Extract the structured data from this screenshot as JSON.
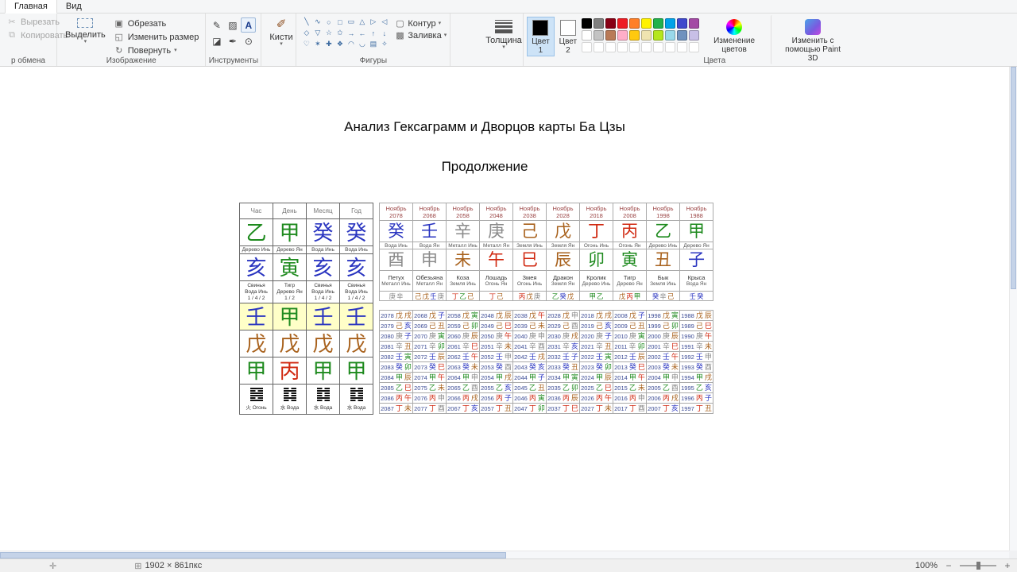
{
  "icons": {
    "cut": "✂",
    "copy": "⧉",
    "crop": "▣",
    "resize": "◱",
    "rotate": "↻",
    "pencil": "✎",
    "fill": "▨",
    "text": "A",
    "eraser": "◪",
    "eyedropper": "✒",
    "magnifier": "⊙",
    "brush": "✐",
    "outline": "▢",
    "fill_shape": "▩",
    "caret": "▾",
    "position": "✛",
    "canvas_size": "⊞",
    "zoom_out": "−",
    "zoom_in": "+"
  },
  "ribbon": {
    "tabs": [
      {
        "label": "Главная",
        "active": true
      },
      {
        "label": "Вид",
        "active": false
      }
    ],
    "clipboard": {
      "cut": "Вырезать",
      "copy": "Копировать",
      "group_label": "р обмена"
    },
    "image": {
      "select": "Выделить",
      "crop": "Обрезать",
      "resize": "Изменить размер",
      "rotate": "Повернуть",
      "group_label": "Изображение"
    },
    "tools": {
      "group_label": "Инструменты"
    },
    "brushes": {
      "label": "Кисти"
    },
    "shapes": {
      "glyphs": [
        "╲",
        "∿",
        "○",
        "□",
        "▭",
        "△",
        "▷",
        "◁",
        "◇",
        "▽",
        "☆",
        "✩",
        "→",
        "←",
        "↑",
        "↓",
        "♡",
        "✶",
        "✚",
        "❖",
        "◠",
        "◡",
        "▤",
        "✧"
      ],
      "outline": "Контур",
      "fill": "Заливка",
      "group_label": "Фигуры"
    },
    "size": {
      "label": "Толщина"
    },
    "color1": {
      "label": "Цвет",
      "number": "1",
      "value": "#000000"
    },
    "color2": {
      "label": "Цвет",
      "number": "2",
      "value": "#ffffff"
    },
    "palette": {
      "row1": [
        "#000000",
        "#7f7f7f",
        "#880015",
        "#ed1c24",
        "#ff7f27",
        "#fff200",
        "#22b14c",
        "#00a2e8",
        "#3f48cc",
        "#a349a4"
      ],
      "row2": [
        "#ffffff",
        "#c3c3c3",
        "#b97a57",
        "#ffaec9",
        "#ffc90e",
        "#efe4b0",
        "#b5e61d",
        "#99d9ea",
        "#7092be",
        "#c8bfe7"
      ],
      "empty_count": 10,
      "group_label": "Цвета"
    },
    "edit_colors": "Изменение цветов",
    "paint3d": "Изменить с помощью Paint 3D"
  },
  "canvas": {
    "title": "Анализ Гексаграмм и Дворцов карты Ба Цзы",
    "subtitle": "Продолжение",
    "element_colors": {
      "wood": "#1e8a1e",
      "fire": "#d02810",
      "earth": "#a8611c",
      "metal": "#8a8a8a",
      "water": "#2a35c0"
    },
    "char_elements": {
      "甲": "wood",
      "乙": "wood",
      "丙": "fire",
      "丁": "fire",
      "戊": "earth",
      "己": "earth",
      "庚": "metal",
      "辛": "metal",
      "壬": "water",
      "癸": "water",
      "子": "water",
      "丑": "earth",
      "寅": "wood",
      "卯": "wood",
      "辰": "earth",
      "巳": "fire",
      "午": "fire",
      "未": "earth",
      "申": "metal",
      "酉": "metal",
      "戌": "earth",
      "亥": "water"
    },
    "pillars_table": {
      "headers": [
        "Час",
        "День",
        "Месяц",
        "Год"
      ],
      "stems": [
        "乙",
        "甲",
        "癸",
        "癸"
      ],
      "stem_labels": [
        "Дерево Инь",
        "Дерево Ян",
        "Вода Инь",
        "Вода Инь"
      ],
      "branches": [
        "亥",
        "寅",
        "亥",
        "亥"
      ],
      "branch_info": [
        [
          "Свинья",
          "Вода Инь",
          "1 / 4 / 2"
        ],
        [
          "Тигр",
          "Дерево Ян",
          "1 / 2"
        ],
        [
          "Свинья",
          "Вода Инь",
          "1 / 4 / 2"
        ],
        [
          "Свинья",
          "Вода Инь",
          "1 / 4 / 2"
        ]
      ],
      "hidden_rows": [
        {
          "highlight": true,
          "chars": [
            "壬",
            "甲",
            "壬",
            "壬"
          ]
        },
        {
          "highlight": false,
          "chars": [
            "戊",
            "戊",
            "戊",
            "戊"
          ]
        },
        {
          "highlight": false,
          "chars": [
            "甲",
            "丙",
            "甲",
            "甲"
          ]
        }
      ],
      "hexagrams": [
        {
          "lines": [
            1,
            0,
            1,
            1,
            0,
            1
          ],
          "label": "火 Огонь"
        },
        {
          "lines": [
            0,
            1,
            0,
            0,
            1,
            0
          ],
          "label": "水 Вода"
        },
        {
          "lines": [
            0,
            1,
            0,
            0,
            1,
            0
          ],
          "label": "水 Вода"
        },
        {
          "lines": [
            0,
            1,
            0,
            0,
            1,
            0
          ],
          "label": "水 Вода"
        }
      ]
    },
    "luck_table": {
      "columns": [
        {
          "month": "Ноябрь",
          "year": "2078",
          "stem": "癸",
          "stem_label": "Вода Инь",
          "branch": "酉",
          "animal": "Петух",
          "branch_label": "Металл Инь",
          "hidden": "庚辛"
        },
        {
          "month": "Ноябрь",
          "year": "2068",
          "stem": "壬",
          "stem_label": "Вода Ян",
          "branch": "申",
          "animal": "Обезьяна",
          "branch_label": "Металл Ян",
          "hidden": "己戊壬庚"
        },
        {
          "month": "Ноябрь",
          "year": "2058",
          "stem": "辛",
          "stem_label": "Металл Инь",
          "branch": "未",
          "animal": "Коза",
          "branch_label": "Земля Инь",
          "hidden": "丁乙己"
        },
        {
          "month": "Ноябрь",
          "year": "2048",
          "stem": "庚",
          "stem_label": "Металл Ян",
          "branch": "午",
          "animal": "Лошадь",
          "branch_label": "Огонь Ян",
          "hidden": "丁己"
        },
        {
          "month": "Ноябрь",
          "year": "2038",
          "stem": "己",
          "stem_label": "Земля Инь",
          "branch": "巳",
          "animal": "Змея",
          "branch_label": "Огонь Инь",
          "hidden": "丙戊庚"
        },
        {
          "month": "Ноябрь",
          "year": "2028",
          "stem": "戊",
          "stem_label": "Земля Ян",
          "branch": "辰",
          "animal": "Дракон",
          "branch_label": "Земля Ян",
          "hidden": "乙癸戊"
        },
        {
          "month": "Ноябрь",
          "year": "2018",
          "stem": "丁",
          "stem_label": "Огонь Инь",
          "branch": "卯",
          "animal": "Кролик",
          "branch_label": "Дерево Инь",
          "hidden": "甲乙"
        },
        {
          "month": "Ноябрь",
          "year": "2008",
          "stem": "丙",
          "stem_label": "Огонь Ян",
          "branch": "寅",
          "animal": "Тигр",
          "branch_label": "Дерево Ян",
          "hidden": "戊丙甲"
        },
        {
          "month": "Ноябрь",
          "year": "1998",
          "stem": "乙",
          "stem_label": "Дерево Инь",
          "branch": "丑",
          "animal": "Бык",
          "branch_label": "Земля Инь",
          "hidden": "癸辛己"
        },
        {
          "month": "Ноябрь",
          "year": "1988",
          "stem": "甲",
          "stem_label": "Дерево Ян",
          "branch": "子",
          "animal": "Крыса",
          "branch_label": "Вода Ян",
          "hidden": "壬癸"
        }
      ]
    },
    "years_table": {
      "columns": [
        {
          "cells": [
            [
              "2078",
              "戊戌"
            ],
            [
              "2079",
              "己亥"
            ],
            [
              "2080",
              "庚子"
            ],
            [
              "2081",
              "辛丑"
            ],
            [
              "2082",
              "壬寅"
            ],
            [
              "2083",
              "癸卯"
            ],
            [
              "2084",
              "甲辰"
            ],
            [
              "2085",
              "乙巳"
            ],
            [
              "2086",
              "丙午"
            ],
            [
              "2087",
              "丁未"
            ]
          ]
        },
        {
          "cells": [
            [
              "2068",
              "戊子"
            ],
            [
              "2069",
              "己丑"
            ],
            [
              "2070",
              "庚寅"
            ],
            [
              "2071",
              "辛卯"
            ],
            [
              "2072",
              "壬辰"
            ],
            [
              "2073",
              "癸巳"
            ],
            [
              "2074",
              "甲午"
            ],
            [
              "2075",
              "乙未"
            ],
            [
              "2076",
              "丙申"
            ],
            [
              "2077",
              "丁酉"
            ]
          ]
        },
        {
          "cells": [
            [
              "2058",
              "戊寅"
            ],
            [
              "2059",
              "己卯"
            ],
            [
              "2060",
              "庚辰"
            ],
            [
              "2061",
              "辛巳"
            ],
            [
              "2062",
              "壬午"
            ],
            [
              "2063",
              "癸未"
            ],
            [
              "2064",
              "甲申"
            ],
            [
              "2065",
              "乙酉"
            ],
            [
              "2066",
              "丙戌"
            ],
            [
              "2067",
              "丁亥"
            ]
          ]
        },
        {
          "cells": [
            [
              "2048",
              "戊辰"
            ],
            [
              "2049",
              "己巳"
            ],
            [
              "2050",
              "庚午"
            ],
            [
              "2051",
              "辛未"
            ],
            [
              "2052",
              "壬申"
            ],
            [
              "2053",
              "癸酉"
            ],
            [
              "2054",
              "甲戌"
            ],
            [
              "2055",
              "乙亥"
            ],
            [
              "2056",
              "丙子"
            ],
            [
              "2057",
              "丁丑"
            ]
          ]
        },
        {
          "cells": [
            [
              "2038",
              "戊午"
            ],
            [
              "2039",
              "己未"
            ],
            [
              "2040",
              "庚申"
            ],
            [
              "2041",
              "辛酉"
            ],
            [
              "2042",
              "壬戌"
            ],
            [
              "2043",
              "癸亥"
            ],
            [
              "2044",
              "甲子"
            ],
            [
              "2045",
              "乙丑"
            ],
            [
              "2046",
              "丙寅"
            ],
            [
              "2047",
              "丁卯"
            ]
          ]
        },
        {
          "cells": [
            [
              "2028",
              "戊申"
            ],
            [
              "2029",
              "己酉"
            ],
            [
              "2030",
              "庚戌"
            ],
            [
              "2031",
              "辛亥"
            ],
            [
              "2032",
              "壬子"
            ],
            [
              "2033",
              "癸丑"
            ],
            [
              "2034",
              "甲寅"
            ],
            [
              "2035",
              "乙卯"
            ],
            [
              "2036",
              "丙辰"
            ],
            [
              "2037",
              "丁巳"
            ]
          ]
        },
        {
          "cells": [
            [
              "2018",
              "戊戌"
            ],
            [
              "2019",
              "己亥"
            ],
            [
              "2020",
              "庚子"
            ],
            [
              "2021",
              "辛丑"
            ],
            [
              "2022",
              "壬寅"
            ],
            [
              "2023",
              "癸卯"
            ],
            [
              "2024",
              "甲辰"
            ],
            [
              "2025",
              "乙巳"
            ],
            [
              "2026",
              "丙午"
            ],
            [
              "2027",
              "丁未"
            ]
          ]
        },
        {
          "cells": [
            [
              "2008",
              "戊子"
            ],
            [
              "2009",
              "己丑"
            ],
            [
              "2010",
              "庚寅"
            ],
            [
              "2011",
              "辛卯"
            ],
            [
              "2012",
              "壬辰"
            ],
            [
              "2013",
              "癸巳"
            ],
            [
              "2014",
              "甲午"
            ],
            [
              "2015",
              "乙未"
            ],
            [
              "2016",
              "丙申"
            ],
            [
              "2017",
              "丁酉"
            ]
          ]
        },
        {
          "cells": [
            [
              "1998",
              "戊寅"
            ],
            [
              "1999",
              "己卯"
            ],
            [
              "2000",
              "庚辰"
            ],
            [
              "2001",
              "辛巳"
            ],
            [
              "2002",
              "壬午"
            ],
            [
              "2003",
              "癸未"
            ],
            [
              "2004",
              "甲申"
            ],
            [
              "2005",
              "乙酉"
            ],
            [
              "2006",
              "丙戌"
            ],
            [
              "2007",
              "丁亥"
            ]
          ]
        },
        {
          "cells": [
            [
              "1988",
              "戊辰"
            ],
            [
              "1989",
              "己巳"
            ],
            [
              "1990",
              "庚午"
            ],
            [
              "1991",
              "辛未"
            ],
            [
              "1992",
              "壬申"
            ],
            [
              "1993",
              "癸酉"
            ],
            [
              "1994",
              "甲戌"
            ],
            [
              "1995",
              "乙亥"
            ],
            [
              "1996",
              "丙子"
            ],
            [
              "1997",
              "丁丑"
            ]
          ]
        }
      ]
    }
  },
  "statusbar": {
    "canvas_size": "1902 × 861пкс",
    "zoom": "100%"
  }
}
